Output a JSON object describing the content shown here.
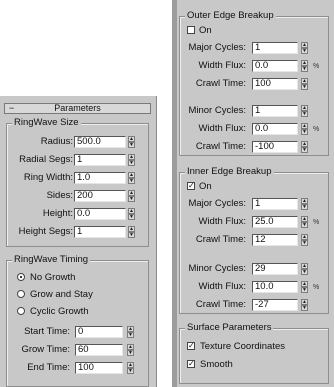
{
  "left": {
    "rollout_sign": "−",
    "rollout_title": "Parameters",
    "ringwave_size": {
      "title": "RingWave Size",
      "radius_label": "Radius:",
      "radius_value": "500.0",
      "radial_segs_label": "Radial Segs:",
      "radial_segs_value": "1",
      "ring_width_label": "Ring Width:",
      "ring_width_value": "1.0",
      "sides_label": "Sides:",
      "sides_value": "200",
      "height_label": "Height:",
      "height_value": "0.0",
      "height_segs_label": "Height Segs:",
      "height_segs_value": "1"
    },
    "ringwave_timing": {
      "title": "RingWave Timing",
      "no_growth_label": "No Growth",
      "grow_and_stay_label": "Grow and Stay",
      "cyclic_growth_label": "Cyclic Growth",
      "selected": "No Growth",
      "start_time_label": "Start Time:",
      "start_time_value": "0",
      "grow_time_label": "Grow Time:",
      "grow_time_value": "60",
      "end_time_label": "End Time:",
      "end_time_value": "100"
    }
  },
  "right": {
    "outer": {
      "title": "Outer Edge Breakup",
      "on_label": "On",
      "on_checked": false,
      "major_cycles_label": "Major Cycles:",
      "major_cycles_value": "1",
      "major_width_flux_label": "Width Flux:",
      "major_width_flux_value": "0.0",
      "major_crawl_label": "Crawl Time:",
      "major_crawl_value": "100",
      "minor_cycles_label": "Minor Cycles:",
      "minor_cycles_value": "1",
      "minor_width_flux_label": "Width Flux:",
      "minor_width_flux_value": "0.0",
      "minor_crawl_label": "Crawl Time:",
      "minor_crawl_value": "-100",
      "percent": "%"
    },
    "inner": {
      "title": "Inner Edge Breakup",
      "on_label": "On",
      "on_checked": true,
      "major_cycles_label": "Major Cycles:",
      "major_cycles_value": "1",
      "major_width_flux_label": "Width Flux:",
      "major_width_flux_value": "25.0",
      "major_crawl_label": "Crawl Time:",
      "major_crawl_value": "12",
      "minor_cycles_label": "Minor Cycles:",
      "minor_cycles_value": "29",
      "minor_width_flux_label": "Width Flux:",
      "minor_width_flux_value": "10.0",
      "minor_crawl_label": "Crawl Time:",
      "minor_crawl_value": "-27",
      "percent": "%"
    },
    "surface": {
      "title": "Surface Parameters",
      "texture_label": "Texture Coordinates",
      "texture_checked": true,
      "smooth_label": "Smooth",
      "smooth_checked": true
    }
  },
  "glyphs": {
    "up": "▲",
    "down": "▼",
    "check": "✓"
  },
  "icons": {
    "spinner": "spinner-arrows-icon",
    "checkbox": "checkbox",
    "radio": "radio-button"
  }
}
